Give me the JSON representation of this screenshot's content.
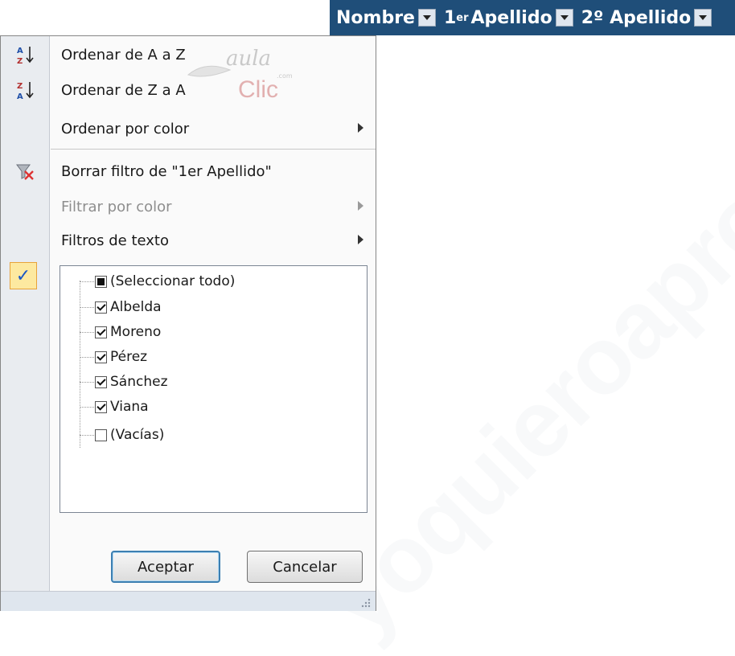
{
  "watermark": "yoquieroaprobar",
  "header": {
    "columns": [
      {
        "label": "Nombre",
        "sup": ""
      },
      {
        "label": "Apellido",
        "prefix": "1",
        "sup": "er"
      },
      {
        "label": "2º Apellido",
        "sup": ""
      }
    ]
  },
  "logo": {
    "top": "aula",
    "dotcom": ".com",
    "bottom": "Clic"
  },
  "menu": {
    "sort_az": "Ordenar de A a Z",
    "sort_za": "Ordenar de Z a A",
    "sort_by_color": "Ordenar por color",
    "clear_filter": "Borrar filtro de \"1er Apellido\"",
    "filter_by_color": "Filtrar por color",
    "text_filters": "Filtros de texto"
  },
  "list": [
    {
      "label": "(Seleccionar todo)",
      "state": "indeterminate"
    },
    {
      "label": "Albelda",
      "state": "checked"
    },
    {
      "label": "Moreno",
      "state": "checked"
    },
    {
      "label": "Pérez",
      "state": "checked"
    },
    {
      "label": "Sánchez",
      "state": "checked"
    },
    {
      "label": "Viana",
      "state": "checked"
    },
    {
      "label": "(Vacías)",
      "state": "unchecked"
    }
  ],
  "buttons": {
    "ok": "Aceptar",
    "cancel": "Cancelar"
  },
  "colors": {
    "header_bg": "#1f4e79",
    "highlight": "#fde9a0",
    "primary_border": "#3c7fb1"
  }
}
